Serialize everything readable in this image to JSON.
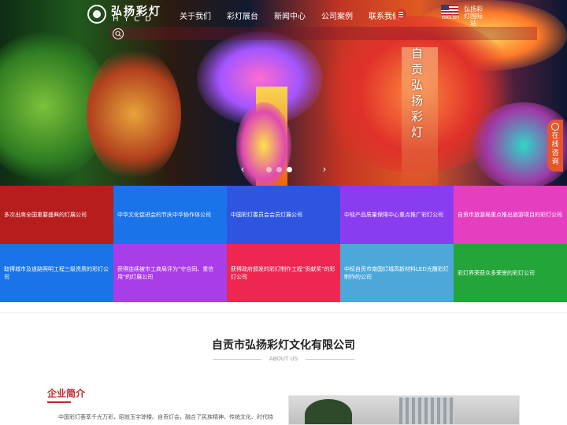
{
  "header": {
    "logo_cn": "弘扬彩灯",
    "logo_en": "HYCD",
    "nav": [
      "关于我们",
      "彩灯展台",
      "新闻中心",
      "公司案例",
      "联系我们"
    ],
    "lang_label": "ENGLISH",
    "intl_label": "弘扬彩灯国际站"
  },
  "hero": {
    "vertical_text": "自贡弘扬彩灯",
    "slide_count": 3,
    "active_slide": 2
  },
  "consult": {
    "label": "在线咨询"
  },
  "tiles": [
    {
      "text": "多次出席全国重要盛典的灯展公司",
      "color": "#b81d1d"
    },
    {
      "text": "中华文化促进会的节庆中华协作体公司",
      "color": "#1a73e8"
    },
    {
      "text": "中国彩灯委员会会员灯展公司",
      "color": "#2f55e0"
    },
    {
      "text": "中轻产品质量保障中心重点推广彩灯公司",
      "color": "#8a3cf0"
    },
    {
      "text": "自贡市旅游局重点推出旅游项目的彩灯公司",
      "color": "#e53fc0"
    },
    {
      "text": "取得城市及道路照明工程三级资质的彩灯公司",
      "color": "#1a73e8"
    },
    {
      "text": "获得连续被市工商局评为\"守合同、重信用\"的灯展公司",
      "color": "#a93dea"
    },
    {
      "text": "获得政府颁发的彩灯制作工程\"贡献奖\"的彩灯公司",
      "color": "#ef2650"
    },
    {
      "text": "中标自贡市南国灯城高新材料LED光雕彩灯制作的公司",
      "color": "#4ca8d8"
    },
    {
      "text": "彩灯界荣获众多荣誉的彩灯公司",
      "color": "#23a53a"
    }
  ],
  "about": {
    "title": "自贡市弘扬彩灯文化有限公司",
    "subtitle": "ABOUT US",
    "intro_heading": "企业简介",
    "intro_text": "中国彩灯荟萃千光万彩，昭就玉宇琼楼。自贡灯会，融合了民族精神、传统文化、时代特"
  }
}
